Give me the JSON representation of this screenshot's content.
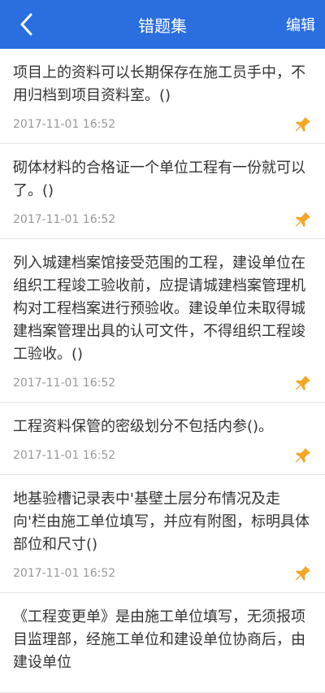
{
  "header": {
    "title": "错题集",
    "edit_label": "编辑"
  },
  "items": [
    {
      "question": "项目上的资料可以长期保存在施工员手中，不用归档到项目资料室。()",
      "time": "2017-11-01 16:52"
    },
    {
      "question": "砌体材料的合格证一个单位工程有一份就可以了。()",
      "time": "2017-11-01 16:52"
    },
    {
      "question": "列入城建档案馆接受范围的工程，建设单位在组织工程竣工验收前，应提请城建档案管理机构对工程档案进行预验收。建设单位未取得城建档案管理出具的认可文件，不得组织工程竣工验收。()",
      "time": "2017-11-01 16:52"
    },
    {
      "question": "工程资料保管的密级划分不包括内参()。",
      "time": "2017-11-01 16:52"
    },
    {
      "question": "地基验槽记录表中'基壁土层分布情况及走向'栏由施工单位填写，并应有附图，标明具体部位和尺寸()",
      "time": "2017-11-01 16:52"
    },
    {
      "question": "《工程变更单》是由施工单位填写，无须报项目监理部，经施工单位和建设单位协商后，由建设单位",
      "time": ""
    }
  ],
  "colors": {
    "header_bg": "#2a6ee0",
    "pin": "#f6a623"
  },
  "icons": {
    "back": "chevron-left-icon",
    "pin": "pin-icon"
  }
}
